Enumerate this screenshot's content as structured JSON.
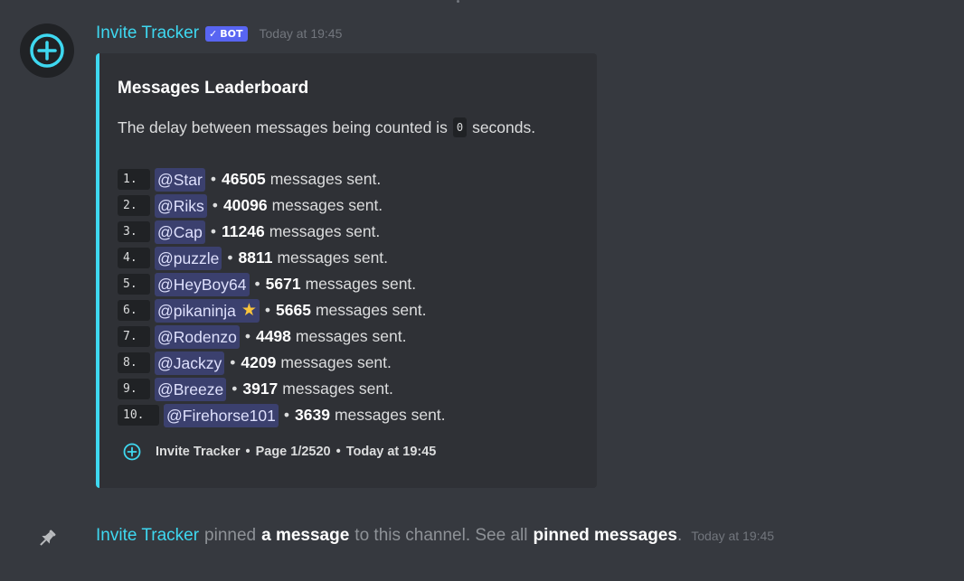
{
  "message": {
    "author": "Invite Tracker",
    "bot_tag": "BOT",
    "bot_check": "✓",
    "timestamp": "Today at 19:45",
    "colors": {
      "accent": "#3ed8f0",
      "bot_tag": "#5865f2",
      "background": "#36393f",
      "embed_bg": "#2f3136"
    },
    "avatar_icon": "plus-circle-icon",
    "embed": {
      "title": "Messages Leaderboard",
      "desc_before": "The delay between messages being counted is",
      "desc_code": "0",
      "desc_after": "seconds.",
      "leaderboard": [
        {
          "rank": "1.",
          "user": "@Star",
          "count": "46505",
          "suffix": "messages sent."
        },
        {
          "rank": "2.",
          "user": "@Riks",
          "count": "40096",
          "suffix": "messages sent."
        },
        {
          "rank": "3.",
          "user": "@Cap",
          "count": "11246",
          "suffix": "messages sent."
        },
        {
          "rank": "4.",
          "user": "@puzzle",
          "count": "8811",
          "suffix": "messages sent."
        },
        {
          "rank": "5.",
          "user": "@HeyBoy64",
          "count": "5671",
          "suffix": "messages sent."
        },
        {
          "rank": "6.",
          "user": "@pikaninja",
          "count": "5665",
          "suffix": "messages sent.",
          "badge": "star-icon"
        },
        {
          "rank": "7.",
          "user": "@Rodenzo",
          "count": "4498",
          "suffix": "messages sent."
        },
        {
          "rank": "8.",
          "user": "@Jackzy",
          "count": "4209",
          "suffix": "messages sent."
        },
        {
          "rank": "9.",
          "user": "@Breeze",
          "count": "3917",
          "suffix": "messages sent."
        },
        {
          "rank": "10.",
          "user": "@Firehorse101",
          "count": "3639",
          "suffix": "messages sent."
        }
      ],
      "separator": "•",
      "footer": {
        "icon": "plus-circle-icon",
        "name": "Invite Tracker",
        "page": "Page 1/2520",
        "time": "Today at 19:45"
      }
    }
  },
  "pin_notice": {
    "icon": "pin-icon",
    "author": "Invite Tracker",
    "pinned": "pinned",
    "a_message": "a message",
    "to_channel": "to this channel. See all",
    "pinned_messages": "pinned messages",
    "period": ".",
    "timestamp": "Today at 19:45"
  }
}
